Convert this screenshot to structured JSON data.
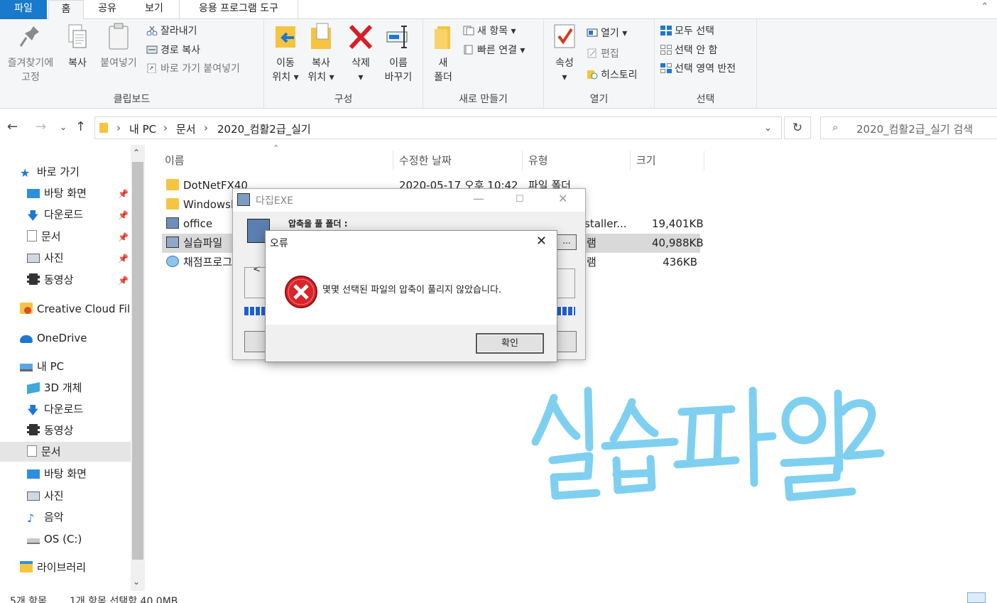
{
  "tabs": {
    "file": "파일",
    "home": "홈",
    "share": "공유",
    "view": "보기",
    "app_tools": "응용 프로그램 도구"
  },
  "ribbon": {
    "pin": {
      "line1": "즐겨찾기에",
      "line2": "고정"
    },
    "copy": "복사",
    "paste": "붙여넣기",
    "cut": "잘라내기",
    "copy_path": "경로 복사",
    "paste_shortcut": "바로 가기 붙여넣기",
    "clipboard_label": "클립보드",
    "move_to": {
      "line1": "이동",
      "line2": "위치 ▾"
    },
    "copy_to": {
      "line1": "복사",
      "line2": "위치 ▾"
    },
    "delete": {
      "line1": "삭제",
      "line2": "▾"
    },
    "rename": {
      "line1": "이름",
      "line2": "바꾸기"
    },
    "organize_label": "구성",
    "new_folder": {
      "line1": "새",
      "line2": "폴더"
    },
    "new_item": "새 항목 ▾",
    "easy_access": "빠른 연결 ▾",
    "new_label": "새로 만들기",
    "properties": {
      "line1": "속성",
      "line2": "▾"
    },
    "open": "열기 ▾",
    "edit": "편집",
    "history": "히스토리",
    "open_label": "열기",
    "select_all": "모두 선택",
    "select_none": "선택 안 함",
    "invert_selection": "선택 영역 반전",
    "select_label": "선택"
  },
  "address": {
    "crumbs": [
      "내 PC",
      "문서",
      "2020_컴활2급_실기"
    ],
    "search_placeholder": "2020_컴활2급_실기 검색"
  },
  "nav": {
    "quick_access": "바로 가기",
    "desktop": "바탕 화면",
    "downloads": "다운로드",
    "documents": "문서",
    "pictures": "사진",
    "videos": "동영상",
    "creative_cloud": "Creative Cloud File",
    "onedrive": "OneDrive",
    "this_pc": "내 PC",
    "objects3d": "3D 개체",
    "pc_downloads": "다운로드",
    "pc_videos": "동영상",
    "pc_documents": "문서",
    "pc_desktop": "바탕 화면",
    "pc_pictures": "사진",
    "music": "음악",
    "os_c": "OS (C:)",
    "libraries": "라이브러리"
  },
  "columns": {
    "name": "이름",
    "modified": "수정한 날짜",
    "type": "유형",
    "size": "크기"
  },
  "files": [
    {
      "name": "DotNetFX40",
      "modified": "2020-05-17 오후 10:42",
      "type": "파일 폴더",
      "size": ""
    },
    {
      "name": "Windowsl",
      "modified": "",
      "type": "",
      "size": ""
    },
    {
      "name": "office",
      "modified": "",
      "type": "staller...",
      "size": "19,401KB"
    },
    {
      "name": "실습파일",
      "modified": "",
      "type": "램",
      "size": "40,988KB"
    },
    {
      "name": "채점프로그",
      "modified": "",
      "type": "램",
      "size": "436KB"
    }
  ],
  "status": {
    "count": "5개 항목",
    "selected": "1개 항목 선택함 40.0MB"
  },
  "zip_dialog": {
    "title": "다집EXE",
    "folder_label": "압축을 풀 폴더 :",
    "browse": "...",
    "arrow": "<"
  },
  "error_dialog": {
    "title": "오류",
    "message": "몇몇 선택된 파일의 압축이 풀리지 않았습니다.",
    "ok": "확인"
  },
  "annotation": "실습파일2",
  "colors": {
    "file_tab": "#1979ca",
    "annotation": "#7fd0f0",
    "error_red": "#d9252a"
  }
}
